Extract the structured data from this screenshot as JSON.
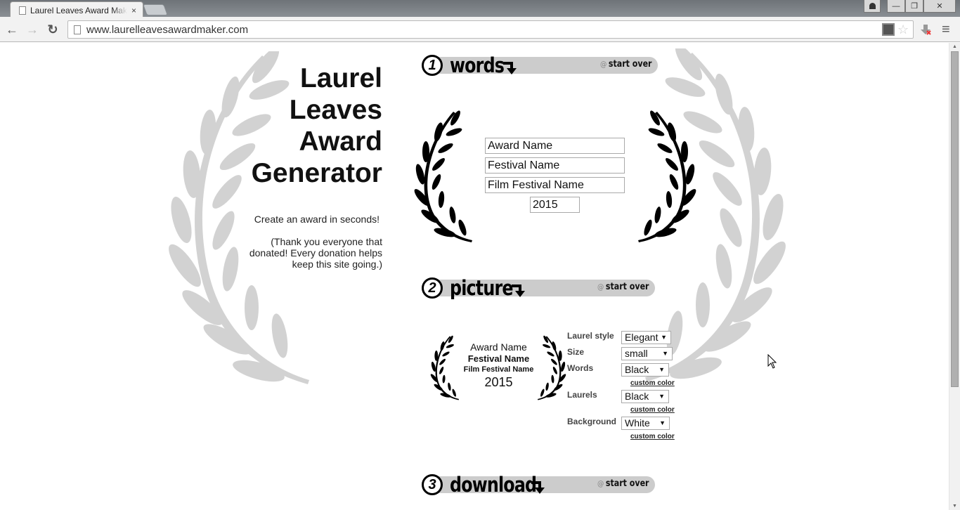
{
  "browser": {
    "tab_title": "Laurel Leaves Award Maker",
    "tab_close": "×",
    "url": "www.laurelleavesawardmaker.com",
    "icons": {
      "back": "←",
      "forward": "→",
      "reload": "↻",
      "menu": "≡",
      "star": "☆",
      "minimize": "—",
      "restore": "❐",
      "close": "✕",
      "user": "👤"
    }
  },
  "hero": {
    "title_lines": [
      "Laurel",
      "Leaves",
      "Award",
      "Generator"
    ],
    "subtitle": "Create an award in seconds!",
    "thanks": "(Thank you everyone that donated! Every donation helps keep this site going.)"
  },
  "steps": [
    {
      "number": "1",
      "label": "words",
      "start_over": "start over"
    },
    {
      "number": "2",
      "label": "picture",
      "start_over": "start over"
    },
    {
      "number": "3",
      "label": "download",
      "start_over": "start over"
    }
  ],
  "words_form": {
    "award_name": "Award Name",
    "festival_name": "Festival Name",
    "film_festival_name": "Film Festival Name",
    "year": "2015"
  },
  "preview": {
    "award_name": "Award Name",
    "festival_name": "Festival Name",
    "film_festival_name": "Film Festival Name",
    "year": "2015"
  },
  "options": {
    "laurel_style": {
      "label": "Laurel style",
      "value": "Elegant"
    },
    "size": {
      "label": "Size",
      "value": "small"
    },
    "words": {
      "label": "Words",
      "value": "Black",
      "custom": "custom color"
    },
    "laurels": {
      "label": "Laurels",
      "value": "Black",
      "custom": "custom color"
    },
    "background": {
      "label": "Background",
      "value": "White",
      "custom": "custom color"
    }
  },
  "colors": {
    "step_bar": "#cccccc",
    "bg_laurel": "#d2d2d2",
    "laurel": "#000000"
  }
}
